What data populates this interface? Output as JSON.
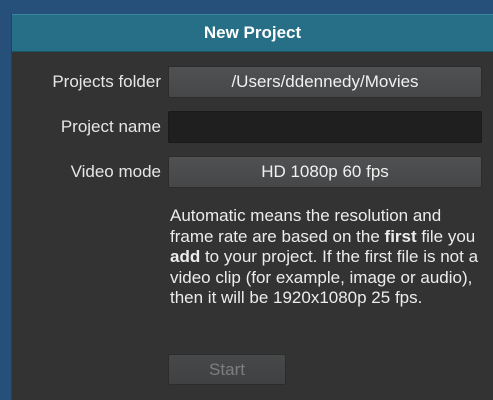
{
  "dialog": {
    "title": "New Project"
  },
  "form": {
    "projects_folder_label": "Projects folder",
    "projects_folder_value": "/Users/ddennedy/Movies",
    "project_name_label": "Project name",
    "project_name_value": "",
    "video_mode_label": "Video mode",
    "video_mode_value": "HD 1080p 60 fps"
  },
  "help": {
    "part1": "Automatic means the resolution and frame rate are based on the ",
    "bold1": "first",
    "part2": " file you ",
    "bold2": "add",
    "part3": " to your project. If the first file is not a video clip (for example, image or audio), then it will be 1920x1080p 25 fps."
  },
  "actions": {
    "start_label": "Start"
  },
  "colors": {
    "background": "#26507a",
    "header": "#266f86",
    "panel": "#333334"
  }
}
